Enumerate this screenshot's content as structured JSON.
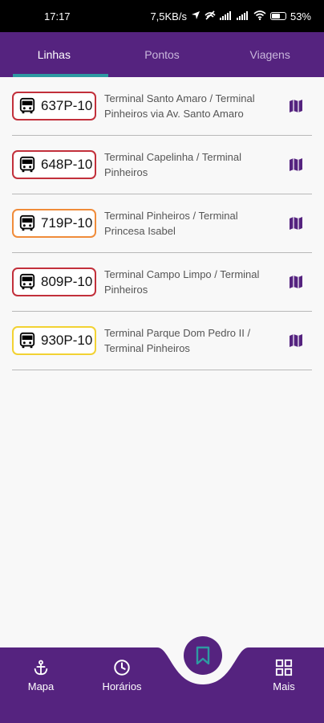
{
  "status_bar": {
    "time": "17:17",
    "network_speed": "7,5KB/s",
    "battery": "53%"
  },
  "tabs": [
    {
      "label": "Linhas",
      "active": true
    },
    {
      "label": "Pontos",
      "active": false
    },
    {
      "label": "Viagens",
      "active": false
    }
  ],
  "routes": [
    {
      "code": "637P-10",
      "description": "Terminal Santo Amaro / Terminal Pinheiros via Av. Santo Amaro",
      "border_color": "#c2303b"
    },
    {
      "code": "648P-10",
      "description": "Terminal Capelinha / Terminal Pinheiros",
      "border_color": "#c2303b"
    },
    {
      "code": "719P-10",
      "description": "Terminal Pinheiros / Terminal Princesa Isabel",
      "border_color": "#f08c3a"
    },
    {
      "code": "809P-10",
      "description": "Terminal Campo Limpo / Terminal Pinheiros",
      "border_color": "#c2303b"
    },
    {
      "code": "930P-10",
      "description": "Terminal Parque Dom Pedro II / Terminal Pinheiros",
      "border_color": "#f2d233"
    }
  ],
  "bottom_nav": {
    "mapa": "Mapa",
    "horarios": "Horários",
    "mais": "Mais"
  },
  "colors": {
    "primary": "#55237f",
    "tab_indicator": "#2e9aa2",
    "background": "#f8f8f8"
  }
}
